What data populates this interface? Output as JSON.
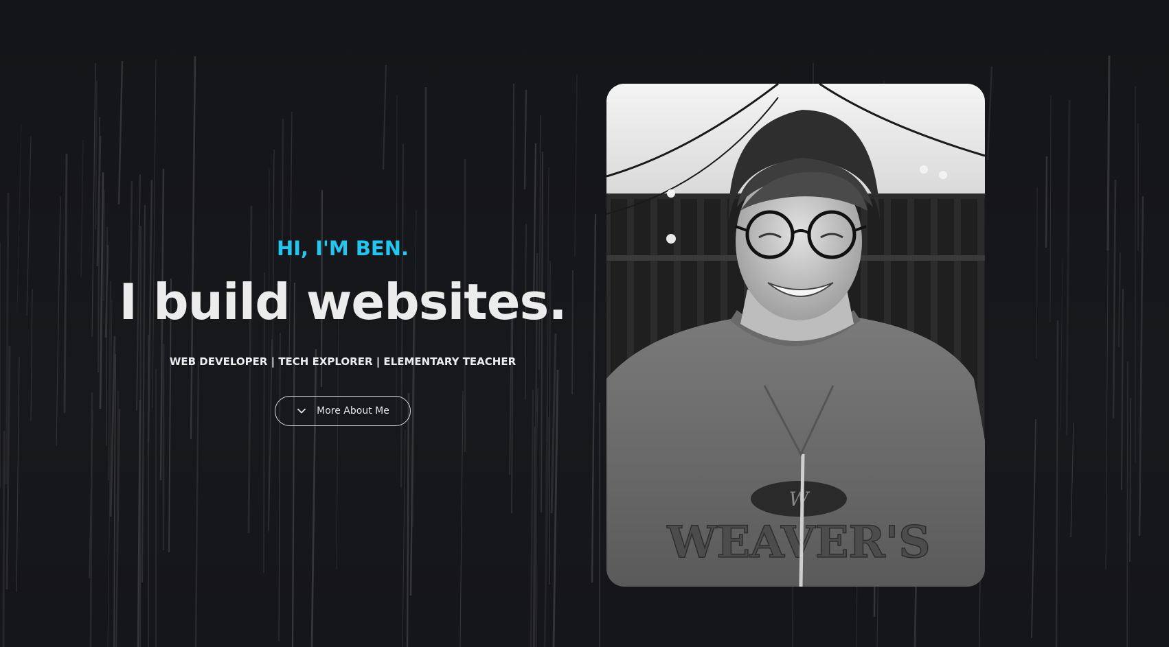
{
  "hero": {
    "greeting": "HI, I'M BEN.",
    "headline": "I build websites.",
    "tagline": "WEB DEVELOPER | TECH EXPLORER | ELEMENTARY TEACHER",
    "cta_label": "More About Me",
    "cta_icon": "chevron-down-icon"
  },
  "portrait": {
    "sweater_text": "WEAVER'S",
    "badge_text": "W"
  },
  "colors": {
    "background": "#151619",
    "accent": "#1ec8f0",
    "text": "#ececec"
  }
}
